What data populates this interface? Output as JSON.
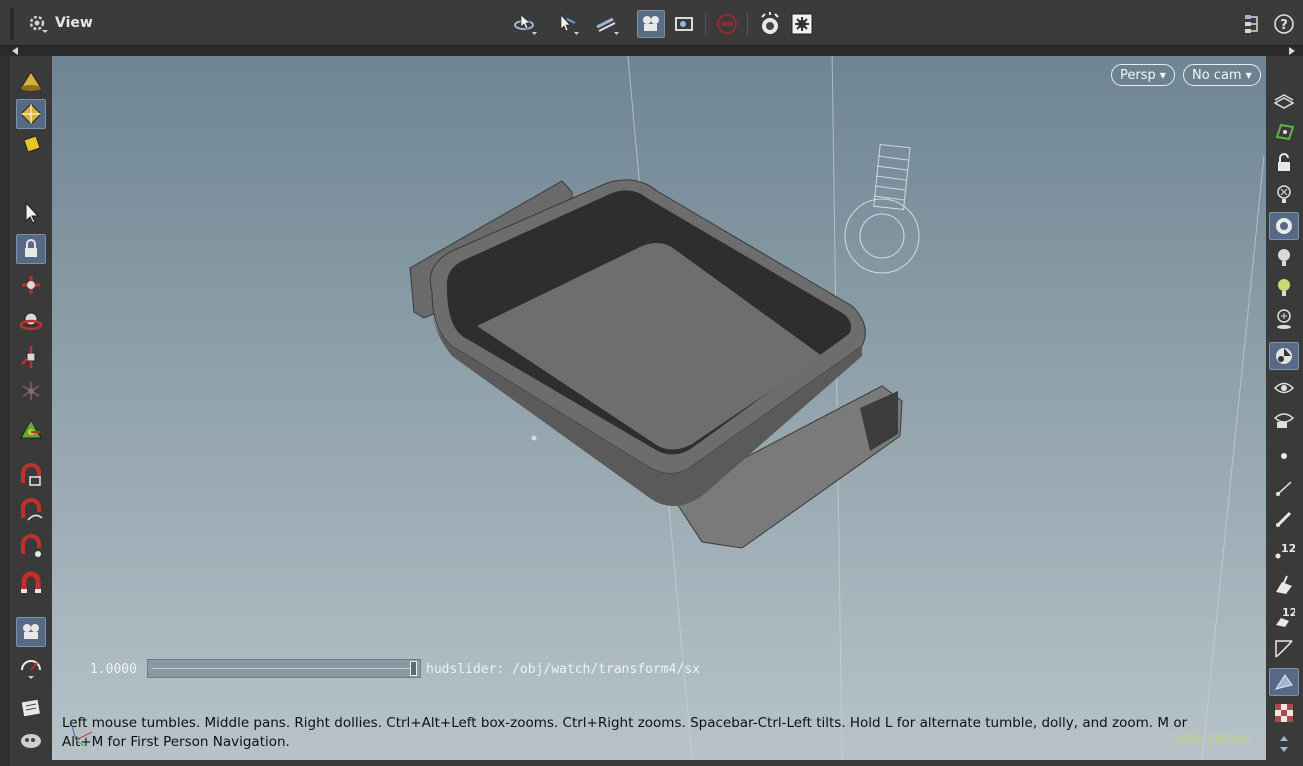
{
  "header": {
    "title": "View"
  },
  "viewport": {
    "persp_label": "Persp",
    "cam_label": "No cam",
    "hud_value": "1.0000",
    "hud_slider_fraction": 1.0,
    "hud_label": "hudslider: /obj/watch/transform4/sx",
    "status_text": "Left mouse tumbles. Middle pans. Right dollies. Ctrl+Alt+Left box-zooms. Ctrl+Right zooms. Spacebar-Ctrl-Left tilts. Hold L for alternate tumble, dolly, and zoom.     M or Alt+M for First Person Navigation.",
    "watermark": "Indie Edition"
  },
  "right_toolbar": {
    "badge_a": "12",
    "badge_b": "12"
  },
  "colors": {
    "accent_active": "#566a86",
    "viewport_top": "#6e8593",
    "viewport_bottom": "#b7c3c9"
  }
}
